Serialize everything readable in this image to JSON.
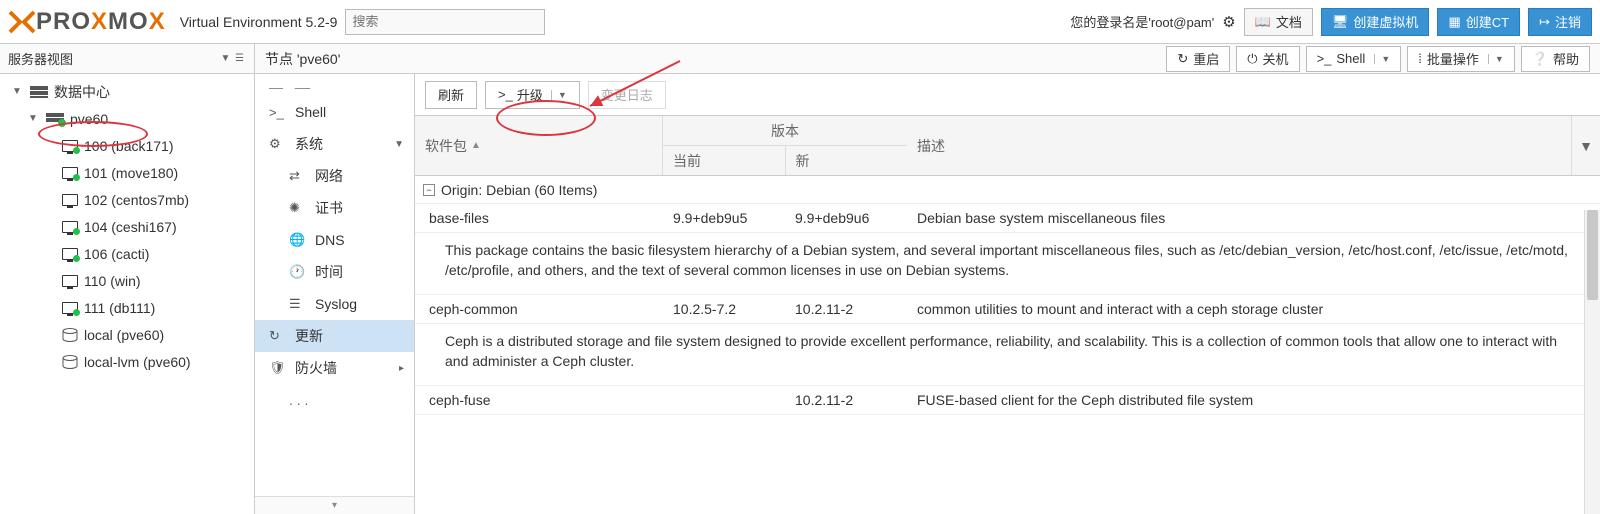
{
  "header": {
    "logo_pre": "PRO",
    "logo_mid": "MO",
    "ve_label": "Virtual Environment 5.2-9",
    "search_placeholder": "搜索",
    "login_text": "您的登录名是'root@pam'",
    "docs": "文档",
    "create_vm": "创建虚拟机",
    "create_ct": "创建CT",
    "logout": "注销"
  },
  "view": {
    "selector": "服务器视图",
    "crumb": "节点 'pve60'",
    "reboot": "重启",
    "shutdown": "关机",
    "shell": "Shell",
    "bulk": "批量操作",
    "help": "帮助"
  },
  "tree": {
    "root": "数据中心",
    "node": "pve60",
    "vms": [
      "100 (back171)",
      "101 (move180)",
      "102 (centos7mb)",
      "104 (ceshi167)",
      "106 (cacti)",
      "110 (win)",
      "111 (db111)"
    ],
    "storage": [
      "local (pve60)",
      "local-lvm (pve60)"
    ]
  },
  "subnav": {
    "shell": "Shell",
    "system": "系统",
    "network": "网络",
    "cert": "证书",
    "dns": "DNS",
    "time": "时间",
    "syslog": "Syslog",
    "updates": "更新",
    "firewall": "防火墙"
  },
  "toolbar": {
    "refresh": "刷新",
    "upgrade": "升级",
    "changelog": "变更日志"
  },
  "grid": {
    "pkg_header": "软件包",
    "ver_header": "版本",
    "cur_header": "当前",
    "new_header": "新",
    "desc_header": "描述",
    "group": "Origin: Debian (60 Items)",
    "rows": [
      {
        "name": "base-files",
        "cur": "9.9+deb9u5",
        "new": "9.9+deb9u6",
        "desc": "Debian base system miscellaneous files",
        "detail": "This package contains the basic filesystem hierarchy of a Debian system, and several important miscellaneous files, such as /etc/debian_version, /etc/host.conf, /etc/issue, /etc/motd, /etc/profile, and others, and the text of several common licenses in use on Debian systems."
      },
      {
        "name": "ceph-common",
        "cur": "10.2.5-7.2",
        "new": "10.2.11-2",
        "desc": "common utilities to mount and interact with a ceph storage cluster",
        "detail": "Ceph is a distributed storage and file system designed to provide excellent performance, reliability, and scalability. This is a collection of common tools that allow one to interact with and administer a Ceph cluster."
      },
      {
        "name": "ceph-fuse",
        "cur": "",
        "new": "10.2.11-2",
        "desc": "FUSE-based client for the Ceph distributed file system",
        "detail": ""
      }
    ]
  }
}
